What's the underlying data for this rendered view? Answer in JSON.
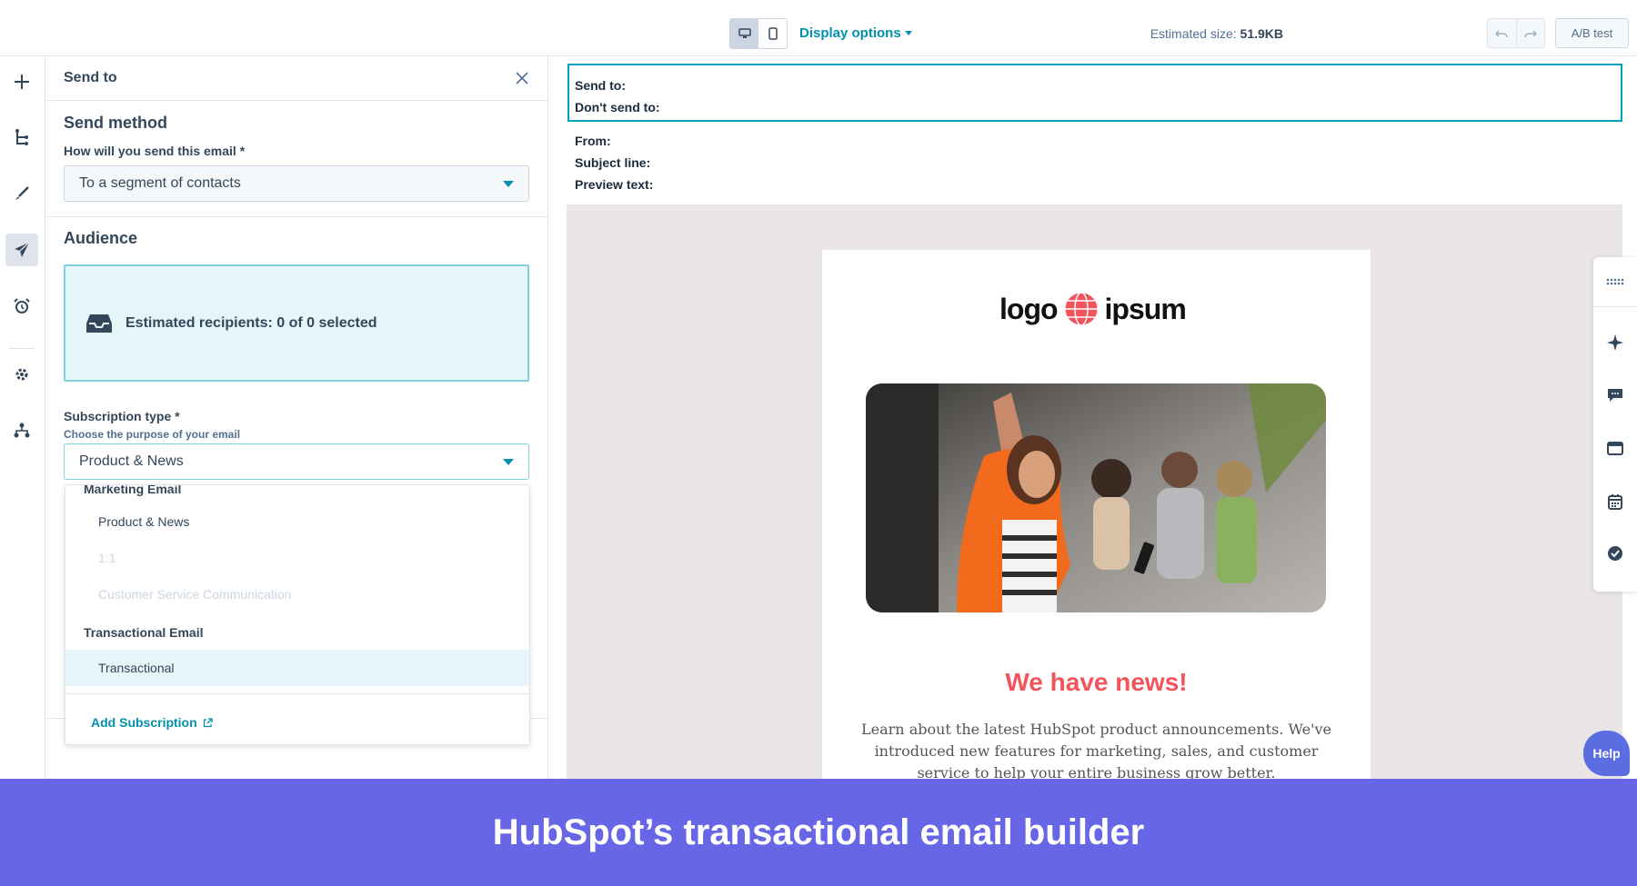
{
  "topbar": {
    "display_options": "Display options",
    "estimated_size_label": "Estimated size: ",
    "estimated_size_value": "51.9KB",
    "ab_test": "A/B test"
  },
  "panel": {
    "title": "Send to",
    "send_method_title": "Send method",
    "send_method_label": "How will you send this email *",
    "send_method_value": "To a segment of contacts",
    "audience_title": "Audience",
    "recipients_text": "Estimated recipients: 0 of 0 selected",
    "subscription_label": "Subscription type *",
    "subscription_help": "Choose the purpose of your email",
    "subscription_value": "Product & News"
  },
  "dropdown": {
    "groups": [
      {
        "label": "Marketing Email",
        "items": [
          {
            "label": "Product & News",
            "disabled": false
          },
          {
            "label": "1:1",
            "disabled": true
          },
          {
            "label": "Customer Service Communication",
            "disabled": true
          }
        ]
      },
      {
        "label": "Transactional Email",
        "items": [
          {
            "label": "Transactional",
            "disabled": false,
            "selected": true
          }
        ]
      }
    ],
    "add_subscription": "Add Subscription"
  },
  "preview": {
    "send_to": "Send to:",
    "dont_send_to": "Don't send to:",
    "from": "From:",
    "subject_line": "Subject line:",
    "preview_text": "Preview text:"
  },
  "email": {
    "logo_left": "logo",
    "logo_right": "ipsum",
    "headline": "We have news!",
    "body": "Learn about the latest HubSpot product announcements. We've introduced new features for marketing, sales, and customer service to help your entire business grow better."
  },
  "help": "Help",
  "banner": "HubSpot’s transactional email builder",
  "colors": {
    "accent": "#0091ae",
    "headline": "#f2545b",
    "banner": "#6666e6",
    "selected_bg": "#e5f5f8"
  },
  "icons": {
    "rail": [
      "plus-icon",
      "tree-icon",
      "brush-icon",
      "paper-plane-icon",
      "alarm-icon",
      "gear-icon",
      "org-chart-icon"
    ],
    "right_rail": [
      "grid-dots-icon",
      "sparkle-icon",
      "comment-icon",
      "window-icon",
      "calendar-icon",
      "check-badge-icon"
    ]
  }
}
